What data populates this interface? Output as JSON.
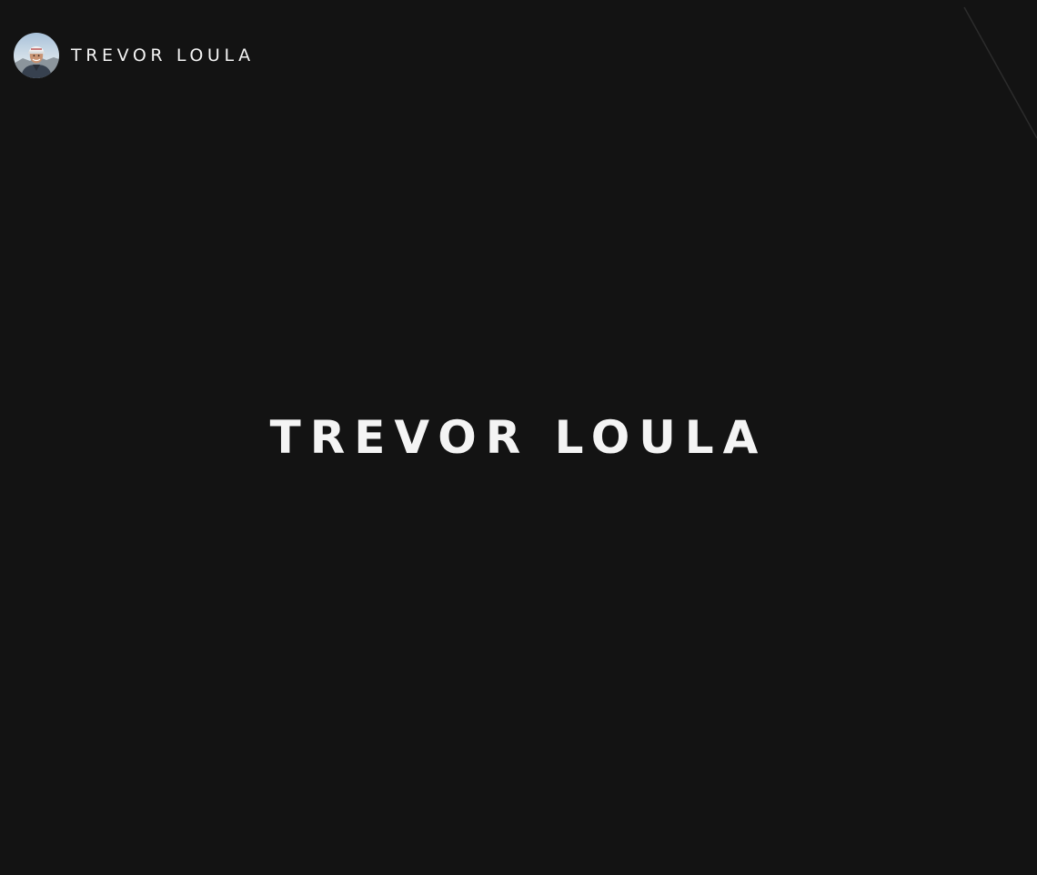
{
  "header": {
    "site_name": "TREVOR LOULA",
    "avatar_icon": "profile-photo"
  },
  "hero": {
    "title": "TREVOR LOULA"
  },
  "colors": {
    "background": "#131313",
    "text": "#f4f4f4",
    "decorative_line": "#2c2c2c"
  }
}
